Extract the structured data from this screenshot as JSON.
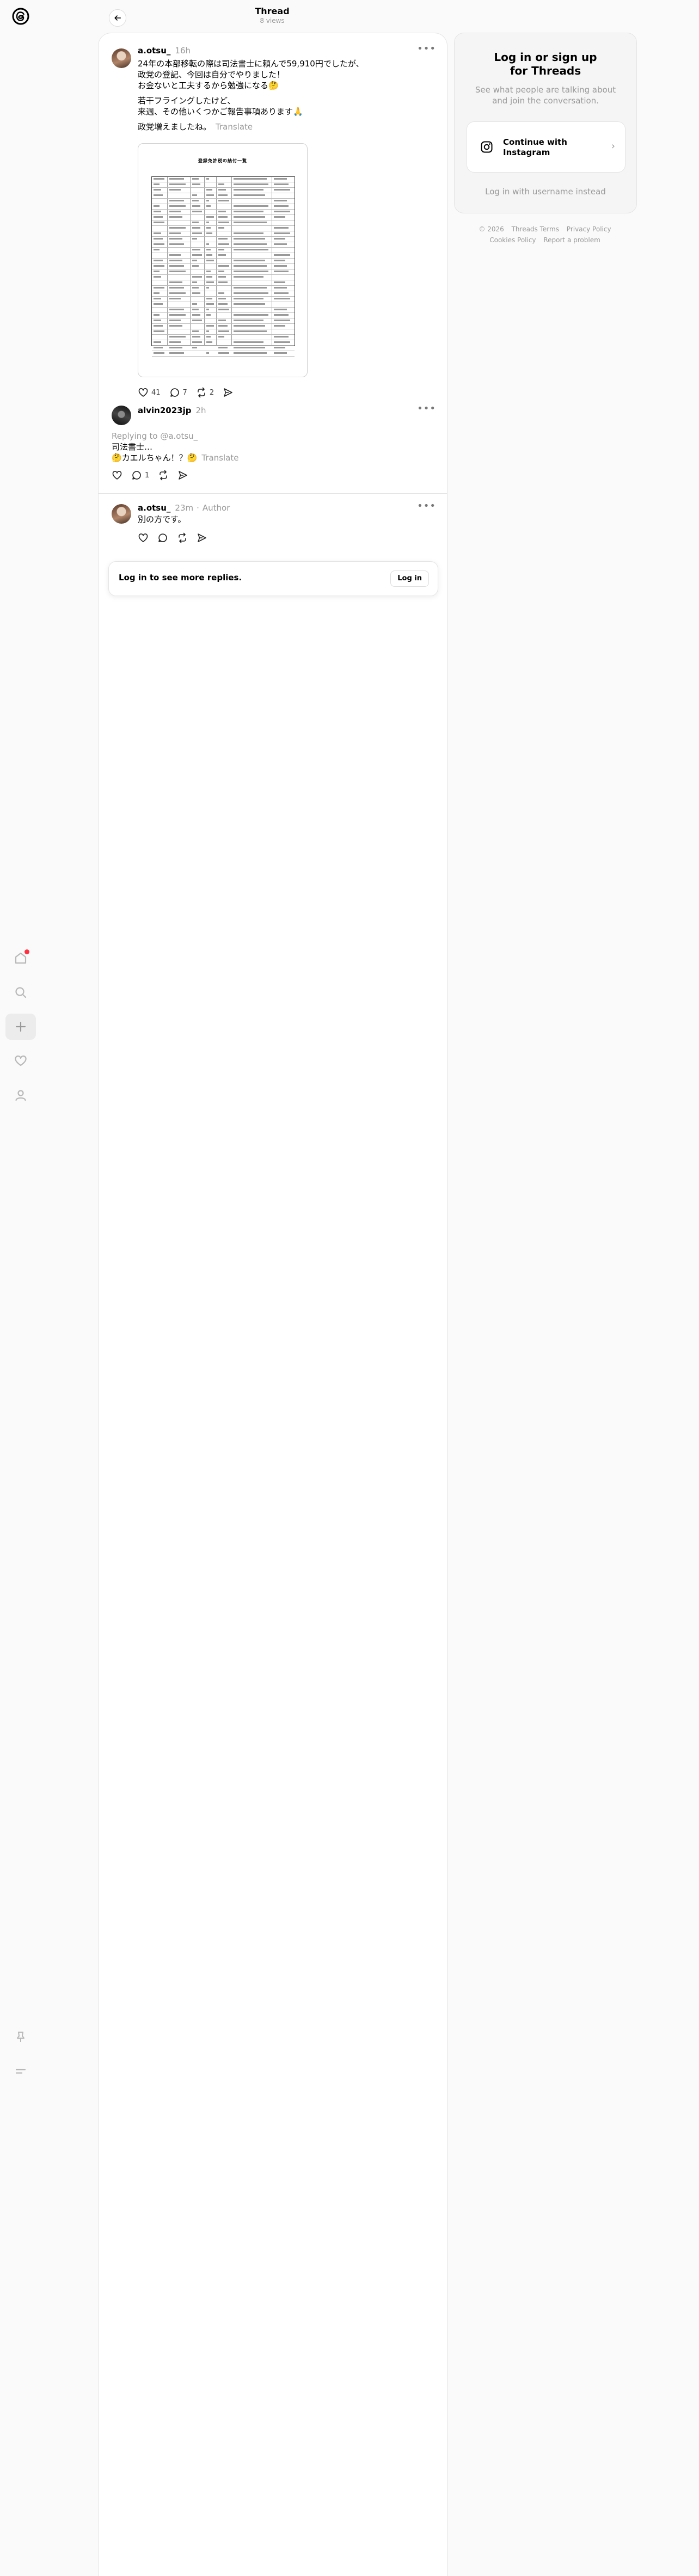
{
  "header": {
    "title": "Thread",
    "views": "8 views"
  },
  "nav": {
    "icons": [
      "threads-logo",
      "home-icon",
      "search-icon",
      "create-icon",
      "activity-icon",
      "profile-icon",
      "pin-icon",
      "menu-icon"
    ]
  },
  "posts": [
    {
      "username": "a.otsu_",
      "time": "16h",
      "lines": [
        "24年の本部移転の際は司法書士に頼んで59,910円でしたが、",
        "政党の登記、今回は自分でやりました！",
        "お金ないと工夫するから勉強になる🤔"
      ],
      "lines2": [
        "若干フライングしたけど、",
        "来週、その他いくつかご報告事項あります🙏"
      ],
      "lines3": "政党増えましたね。",
      "translate": "Translate",
      "image_title": "登録免許税の納付一覧",
      "likes": "41",
      "replies": "7",
      "reposts": "2"
    },
    {
      "username": "alvin2023jp",
      "time": "2h",
      "replying_to": "Replying to @a.otsu_",
      "lines": [
        "司法書士…",
        "🤔カエルちゃん！？🤔"
      ],
      "translate": "Translate",
      "replies": "1"
    },
    {
      "username": "a.otsu_",
      "time": "23m",
      "author": "Author",
      "lines": [
        "別の方です。"
      ]
    }
  ],
  "login_bar": {
    "text": "Log in to see more replies.",
    "button": "Log in"
  },
  "right_panel": {
    "title_line1": "Log in or sign up",
    "title_line2": "for Threads",
    "subtitle": "See what people are talking about and join the conversation.",
    "instagram_button": "Continue with Instagram",
    "username_link": "Log in with username instead"
  },
  "footer": {
    "row1": [
      "© 2026",
      "Threads Terms",
      "Privacy Policy"
    ],
    "row2": [
      "Cookies Policy",
      "Report a problem"
    ]
  },
  "colors": {
    "notification_dot": "#ff3040",
    "muted": "#999999"
  }
}
